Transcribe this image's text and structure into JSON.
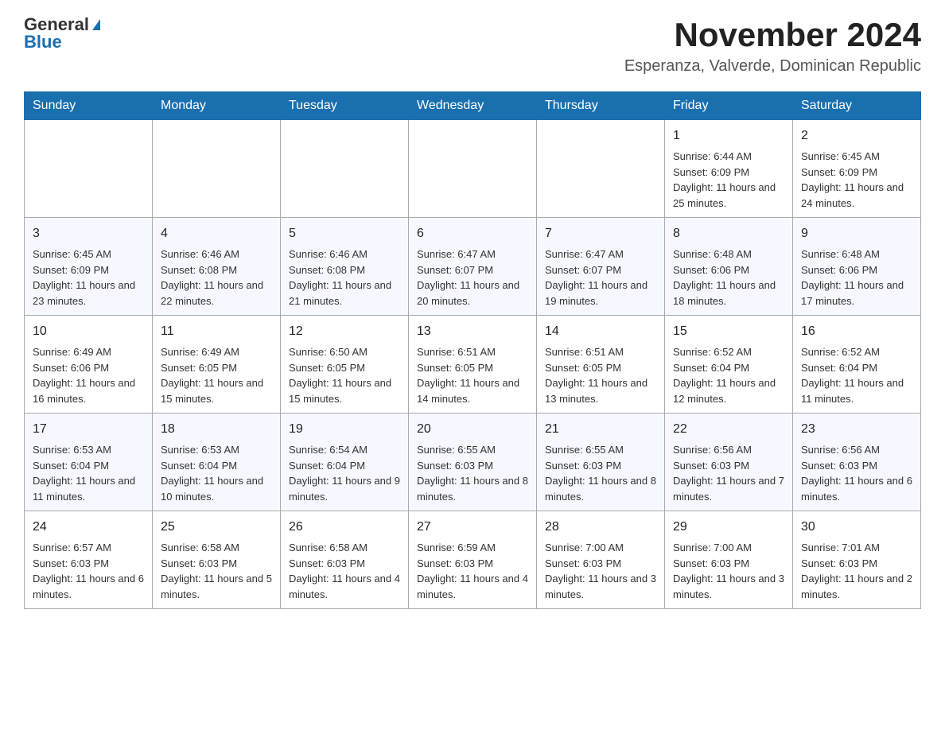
{
  "header": {
    "logo_general": "General",
    "logo_blue": "Blue",
    "month_title": "November 2024",
    "location": "Esperanza, Valverde, Dominican Republic"
  },
  "days_of_week": [
    "Sunday",
    "Monday",
    "Tuesday",
    "Wednesday",
    "Thursday",
    "Friday",
    "Saturday"
  ],
  "weeks": [
    [
      {
        "day": "",
        "info": ""
      },
      {
        "day": "",
        "info": ""
      },
      {
        "day": "",
        "info": ""
      },
      {
        "day": "",
        "info": ""
      },
      {
        "day": "",
        "info": ""
      },
      {
        "day": "1",
        "info": "Sunrise: 6:44 AM\nSunset: 6:09 PM\nDaylight: 11 hours and 25 minutes."
      },
      {
        "day": "2",
        "info": "Sunrise: 6:45 AM\nSunset: 6:09 PM\nDaylight: 11 hours and 24 minutes."
      }
    ],
    [
      {
        "day": "3",
        "info": "Sunrise: 6:45 AM\nSunset: 6:09 PM\nDaylight: 11 hours and 23 minutes."
      },
      {
        "day": "4",
        "info": "Sunrise: 6:46 AM\nSunset: 6:08 PM\nDaylight: 11 hours and 22 minutes."
      },
      {
        "day": "5",
        "info": "Sunrise: 6:46 AM\nSunset: 6:08 PM\nDaylight: 11 hours and 21 minutes."
      },
      {
        "day": "6",
        "info": "Sunrise: 6:47 AM\nSunset: 6:07 PM\nDaylight: 11 hours and 20 minutes."
      },
      {
        "day": "7",
        "info": "Sunrise: 6:47 AM\nSunset: 6:07 PM\nDaylight: 11 hours and 19 minutes."
      },
      {
        "day": "8",
        "info": "Sunrise: 6:48 AM\nSunset: 6:06 PM\nDaylight: 11 hours and 18 minutes."
      },
      {
        "day": "9",
        "info": "Sunrise: 6:48 AM\nSunset: 6:06 PM\nDaylight: 11 hours and 17 minutes."
      }
    ],
    [
      {
        "day": "10",
        "info": "Sunrise: 6:49 AM\nSunset: 6:06 PM\nDaylight: 11 hours and 16 minutes."
      },
      {
        "day": "11",
        "info": "Sunrise: 6:49 AM\nSunset: 6:05 PM\nDaylight: 11 hours and 15 minutes."
      },
      {
        "day": "12",
        "info": "Sunrise: 6:50 AM\nSunset: 6:05 PM\nDaylight: 11 hours and 15 minutes."
      },
      {
        "day": "13",
        "info": "Sunrise: 6:51 AM\nSunset: 6:05 PM\nDaylight: 11 hours and 14 minutes."
      },
      {
        "day": "14",
        "info": "Sunrise: 6:51 AM\nSunset: 6:05 PM\nDaylight: 11 hours and 13 minutes."
      },
      {
        "day": "15",
        "info": "Sunrise: 6:52 AM\nSunset: 6:04 PM\nDaylight: 11 hours and 12 minutes."
      },
      {
        "day": "16",
        "info": "Sunrise: 6:52 AM\nSunset: 6:04 PM\nDaylight: 11 hours and 11 minutes."
      }
    ],
    [
      {
        "day": "17",
        "info": "Sunrise: 6:53 AM\nSunset: 6:04 PM\nDaylight: 11 hours and 11 minutes."
      },
      {
        "day": "18",
        "info": "Sunrise: 6:53 AM\nSunset: 6:04 PM\nDaylight: 11 hours and 10 minutes."
      },
      {
        "day": "19",
        "info": "Sunrise: 6:54 AM\nSunset: 6:04 PM\nDaylight: 11 hours and 9 minutes."
      },
      {
        "day": "20",
        "info": "Sunrise: 6:55 AM\nSunset: 6:03 PM\nDaylight: 11 hours and 8 minutes."
      },
      {
        "day": "21",
        "info": "Sunrise: 6:55 AM\nSunset: 6:03 PM\nDaylight: 11 hours and 8 minutes."
      },
      {
        "day": "22",
        "info": "Sunrise: 6:56 AM\nSunset: 6:03 PM\nDaylight: 11 hours and 7 minutes."
      },
      {
        "day": "23",
        "info": "Sunrise: 6:56 AM\nSunset: 6:03 PM\nDaylight: 11 hours and 6 minutes."
      }
    ],
    [
      {
        "day": "24",
        "info": "Sunrise: 6:57 AM\nSunset: 6:03 PM\nDaylight: 11 hours and 6 minutes."
      },
      {
        "day": "25",
        "info": "Sunrise: 6:58 AM\nSunset: 6:03 PM\nDaylight: 11 hours and 5 minutes."
      },
      {
        "day": "26",
        "info": "Sunrise: 6:58 AM\nSunset: 6:03 PM\nDaylight: 11 hours and 4 minutes."
      },
      {
        "day": "27",
        "info": "Sunrise: 6:59 AM\nSunset: 6:03 PM\nDaylight: 11 hours and 4 minutes."
      },
      {
        "day": "28",
        "info": "Sunrise: 7:00 AM\nSunset: 6:03 PM\nDaylight: 11 hours and 3 minutes."
      },
      {
        "day": "29",
        "info": "Sunrise: 7:00 AM\nSunset: 6:03 PM\nDaylight: 11 hours and 3 minutes."
      },
      {
        "day": "30",
        "info": "Sunrise: 7:01 AM\nSunset: 6:03 PM\nDaylight: 11 hours and 2 minutes."
      }
    ]
  ]
}
